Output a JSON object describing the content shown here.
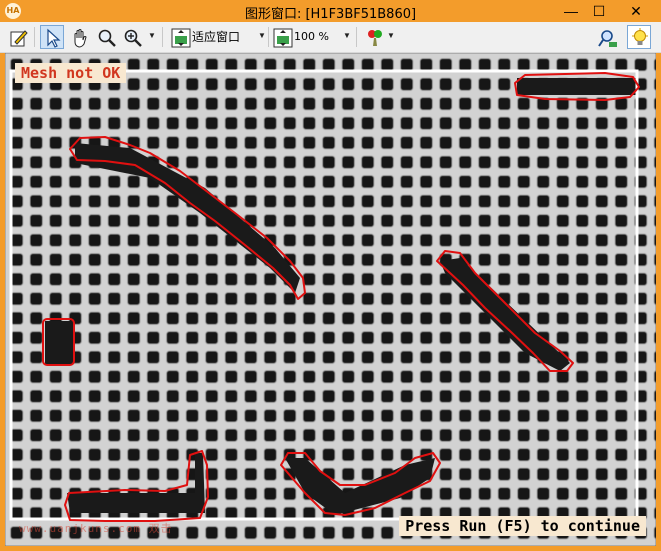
{
  "window": {
    "app_icon_text": "HA",
    "title": "图形窗口: [H1F3BF51B860]",
    "minimize_glyph": "—",
    "maximize_glyph": "☐",
    "close_glyph": "✕"
  },
  "toolbar": {
    "fit_label": "适应窗口",
    "zoom_value": "100 %",
    "icons": [
      "edit-icon",
      "pointer-icon",
      "hand-icon",
      "zoom-icon",
      "fit-window-icon",
      "zoom-percent-icon",
      "color-brush-icon",
      "inspect-icon",
      "lightbulb-icon"
    ]
  },
  "canvas": {
    "status_message": "Mesh not OK",
    "continue_message": "Press Run (F5) to continue",
    "watermark": "www.uanjkuns.com 双击",
    "colors": {
      "defect_outline": "#e01010",
      "roi_rectangle": "#ffffff",
      "mesh_background": "#1c1c1c",
      "mesh_wire": "#cfcfcf"
    }
  }
}
